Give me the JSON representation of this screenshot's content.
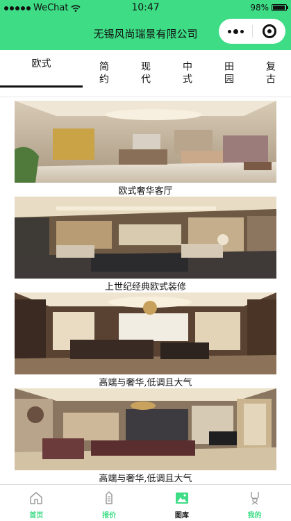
{
  "status_bar": {
    "carrier": "WeChat",
    "time": "10:47",
    "battery": "98%",
    "battery_level": 0.98
  },
  "nav": {
    "title": "无锡风尚瑞景有限公司"
  },
  "tabs": [
    {
      "label": "欧式",
      "active": true
    },
    {
      "label": "简约",
      "active": false
    },
    {
      "label": "现代",
      "active": false
    },
    {
      "label": "中式",
      "active": false
    },
    {
      "label": "田园",
      "active": false
    },
    {
      "label": "复古",
      "active": false
    }
  ],
  "gallery": [
    {
      "caption": "欧式奢华客厅"
    },
    {
      "caption": "上世纪经典欧式装修"
    },
    {
      "caption": "高端与奢华,低调且大气"
    },
    {
      "caption": "高端与奢华,低调且大气"
    }
  ],
  "tabbar": [
    {
      "label": "首页",
      "icon": "home-icon"
    },
    {
      "label": "报价",
      "icon": "quote-icon"
    },
    {
      "label": "图库",
      "icon": "gallery-icon",
      "selected": true
    },
    {
      "label": "我的",
      "icon": "profile-icon"
    }
  ],
  "colors": {
    "accent": "#3ddc85",
    "text": "#111111"
  }
}
